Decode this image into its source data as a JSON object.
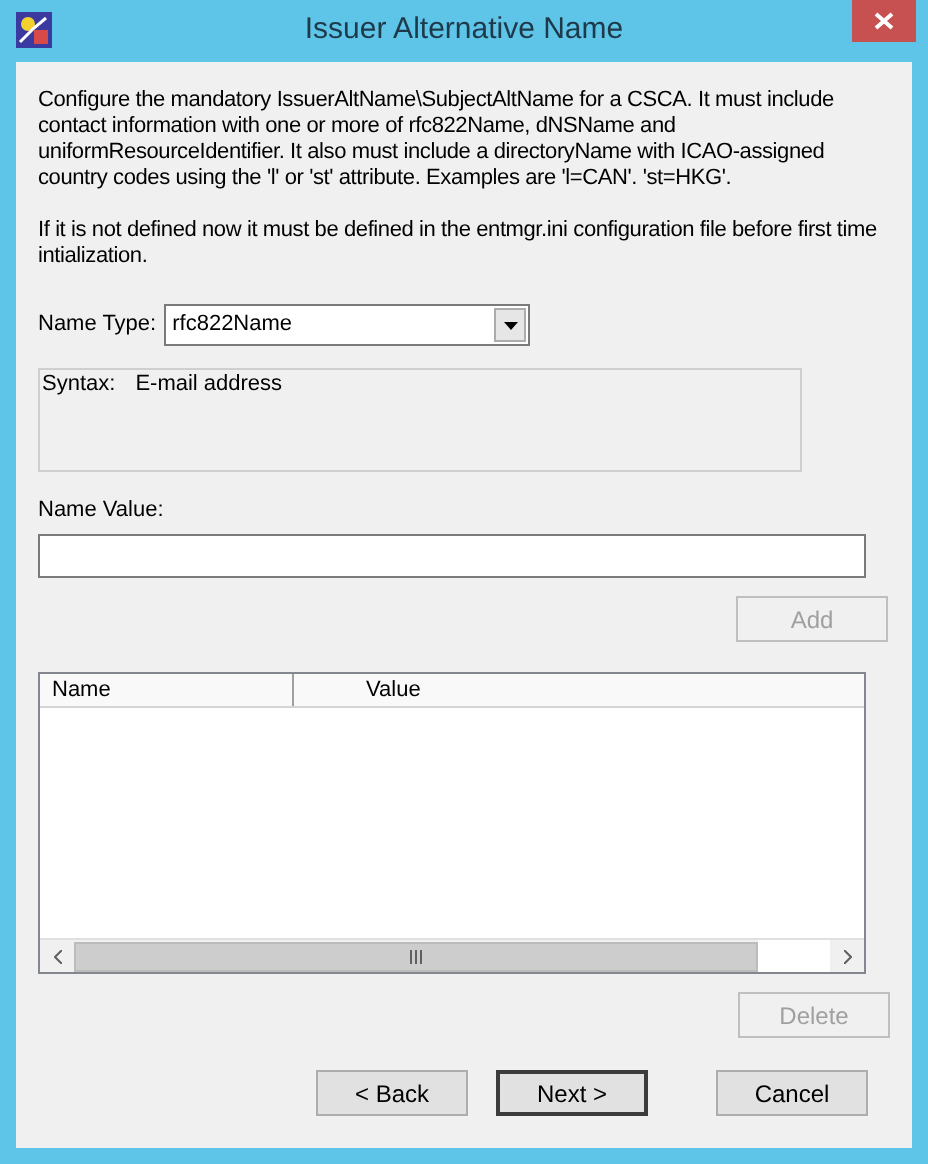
{
  "window": {
    "title": "Issuer Alternative Name"
  },
  "description": [
    "Configure the mandatory IssuerAltName\\SubjectAltName for a CSCA. It must include contact information with one or more of rfc822Name, dNSName and uniformResourceIdentifier. It also must include a directoryName with ICAO-assigned country codes using the 'l' or 'st' attribute. Examples are 'l=CAN'. 'st=HKG'.",
    "If it is not defined now it must be defined in the entmgr.ini configuration file before first time intialization."
  ],
  "name_type": {
    "label": "Name Type:",
    "value": "rfc822Name"
  },
  "syntax": {
    "label": "Syntax:",
    "value": "E-mail address"
  },
  "name_value": {
    "label": "Name Value:"
  },
  "add_button": {
    "label": "Add",
    "disabled": true
  },
  "table": {
    "columns": [
      "Name",
      "Value"
    ]
  },
  "delete_button": {
    "label": "Delete",
    "disabled": true
  },
  "buttons": [
    {
      "label": "< Back",
      "default": false,
      "disabled": false
    },
    {
      "label": "Next >",
      "default": true,
      "disabled": false
    },
    {
      "label": "Cancel",
      "default": false,
      "disabled": false
    }
  ]
}
